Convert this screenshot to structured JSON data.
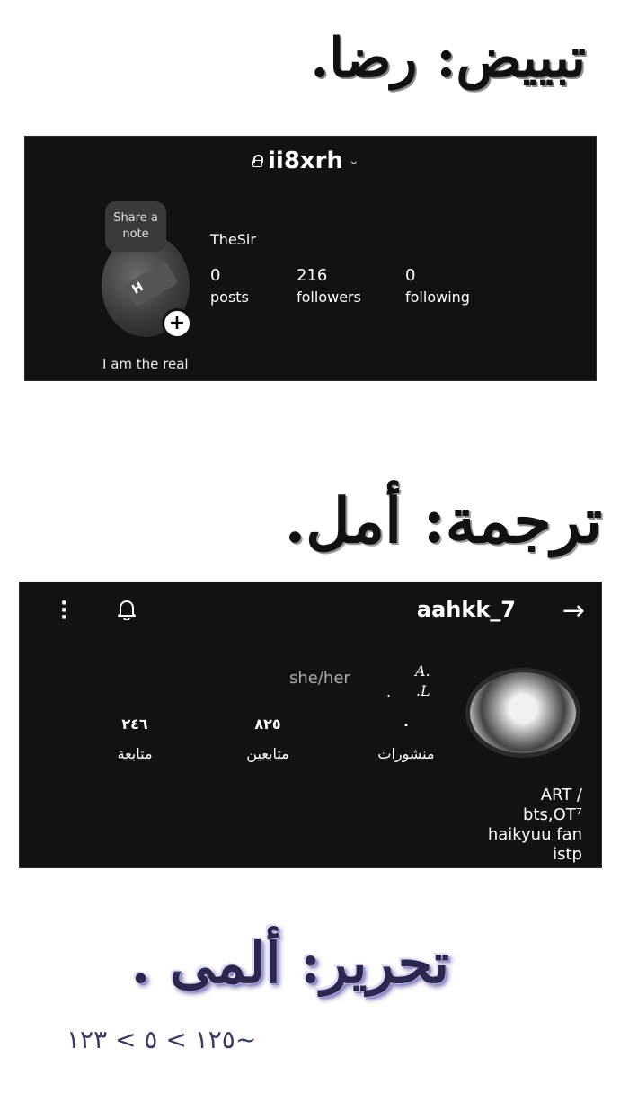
{
  "headings": {
    "whiten": "تبييض: رضا.",
    "translate": "ترجمة: أمل.",
    "edit": "تحرير: ألمى ."
  },
  "date_text": "١٢٥ > ٥ > ١٢٣~",
  "profile1": {
    "username": "ii8xrh",
    "note_label": "Share a note",
    "display_name": "TheSir",
    "stats": {
      "posts_num": "0",
      "posts_label": "posts",
      "followers_num": "216",
      "followers_label": "followers",
      "following_num": "0",
      "following_label": "following"
    },
    "bio": "I am the real",
    "avatar_text": "H"
  },
  "profile2": {
    "username": "aahkk_7",
    "pronouns": "she/her",
    "name_line1": "A.",
    "name_line2": ".L",
    "dot": ".",
    "stats": {
      "posts_num": "٠",
      "posts_label": "منشورات",
      "followers_num": "٨٢٥",
      "followers_label": "متابعين",
      "following_num": "٢٤٦",
      "following_label": "متابعة"
    },
    "bio_lines": [
      "ART /",
      "bts,OT⁷",
      "haikyuu fan",
      "istp"
    ]
  },
  "colors": {
    "card_bg": "#121212",
    "page_bg": "#ffffff"
  }
}
